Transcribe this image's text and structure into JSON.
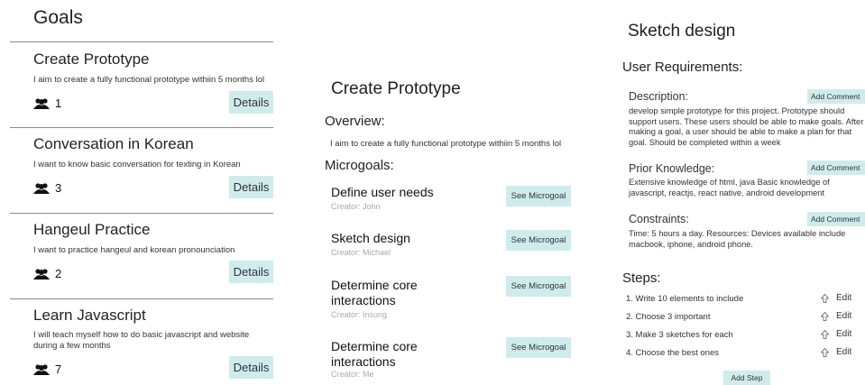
{
  "goals_panel": {
    "title": "Goals",
    "details_label": "Details",
    "goals": [
      {
        "title": "Create Prototype",
        "description": "I aim to create a fully functional prototype withiin 5 months lol",
        "members": "1"
      },
      {
        "title": "Conversation in Korean",
        "description": "I want to know basic conversation for texting in Korean",
        "members": "3"
      },
      {
        "title": "Hangeul Practice",
        "description": "I want to practice hangeul and korean pronounciation",
        "members": "2"
      },
      {
        "title": "Learn Javascript",
        "description": "I will teach myself how to do basic javascript and website during a few months",
        "members": "7"
      }
    ]
  },
  "goal_detail": {
    "title": "Create Prototype",
    "overview_heading": "Overview:",
    "overview_text": "I aim to create a fully functional prototype withiin 5 months lol",
    "microgoals_heading": "Microgoals:",
    "see_label": "See Microgoal",
    "microgoals": [
      {
        "title": "Define user needs",
        "creator": "Creator: John"
      },
      {
        "title": "Sketch design",
        "creator": "Creator: Michael"
      },
      {
        "title": "Determine core interactions",
        "creator": "Creator: Insung"
      },
      {
        "title": "Determine core interactions",
        "creator": "Creator: Me"
      }
    ]
  },
  "microgoal_detail": {
    "title": "Sketch design",
    "requirements_heading": "User Requirements:",
    "add_comment_label": "Add Comment",
    "sections": [
      {
        "heading": "Description:",
        "text": "develop simple prototype for this project. Prototype should support users. These users should be able to make goals. After making a goal, a user should be able to make a plan for that goal. Should be completed within a week"
      },
      {
        "heading": "Prior Knowledge:",
        "text": "Extensive knowledge of html, java Basic knowledge of javascript, reactjs, react native, android development"
      },
      {
        "heading": "Constraints:",
        "text": "Time: 5 hours a day. Resources: Devices available include macbook, iphone, android phone."
      }
    ],
    "steps_heading": "Steps:",
    "edit_label": "Edit",
    "steps": [
      "1. Write 10 elements to include",
      "2. Choose 3 important",
      "3. Make 3 sketches for each",
      "4. Choose the best ones"
    ],
    "add_step_label": "Add Step"
  },
  "icons": {
    "members": "group-icon",
    "edit": "arrow-up-icon"
  }
}
